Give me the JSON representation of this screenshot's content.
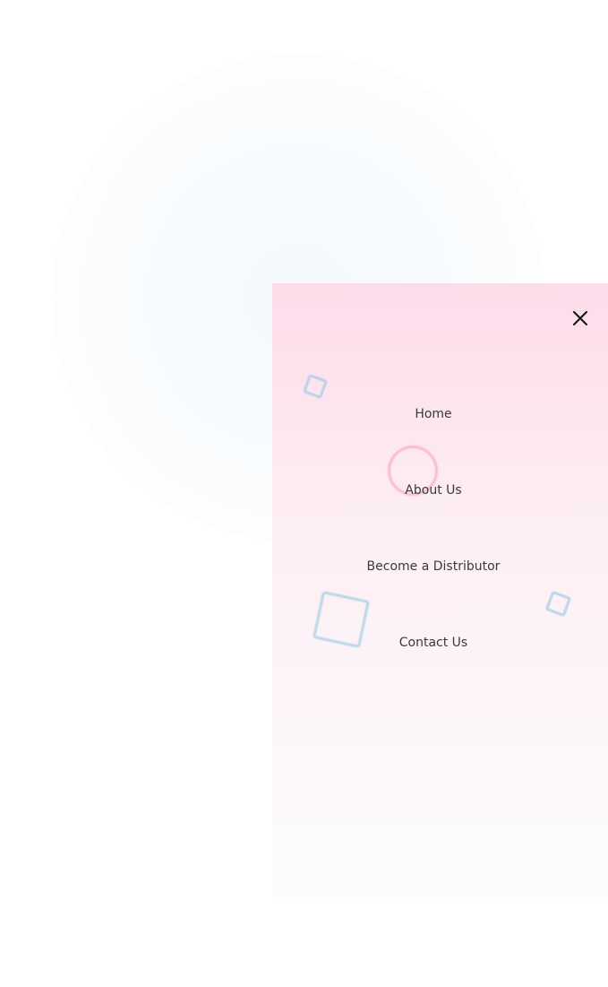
{
  "menu": {
    "close_icon": "close-icon",
    "items": [
      {
        "label": "Home"
      },
      {
        "label": "About Us"
      },
      {
        "label": "Become a Distributor"
      },
      {
        "label": "Contact Us"
      }
    ]
  },
  "colors": {
    "drawer_top": "#fddcea",
    "drawer_bottom": "#fdfcfd",
    "link_text": "#3a3a3a",
    "decor_blue": "#a0cde4",
    "decor_pink": "#f8b2c8"
  }
}
